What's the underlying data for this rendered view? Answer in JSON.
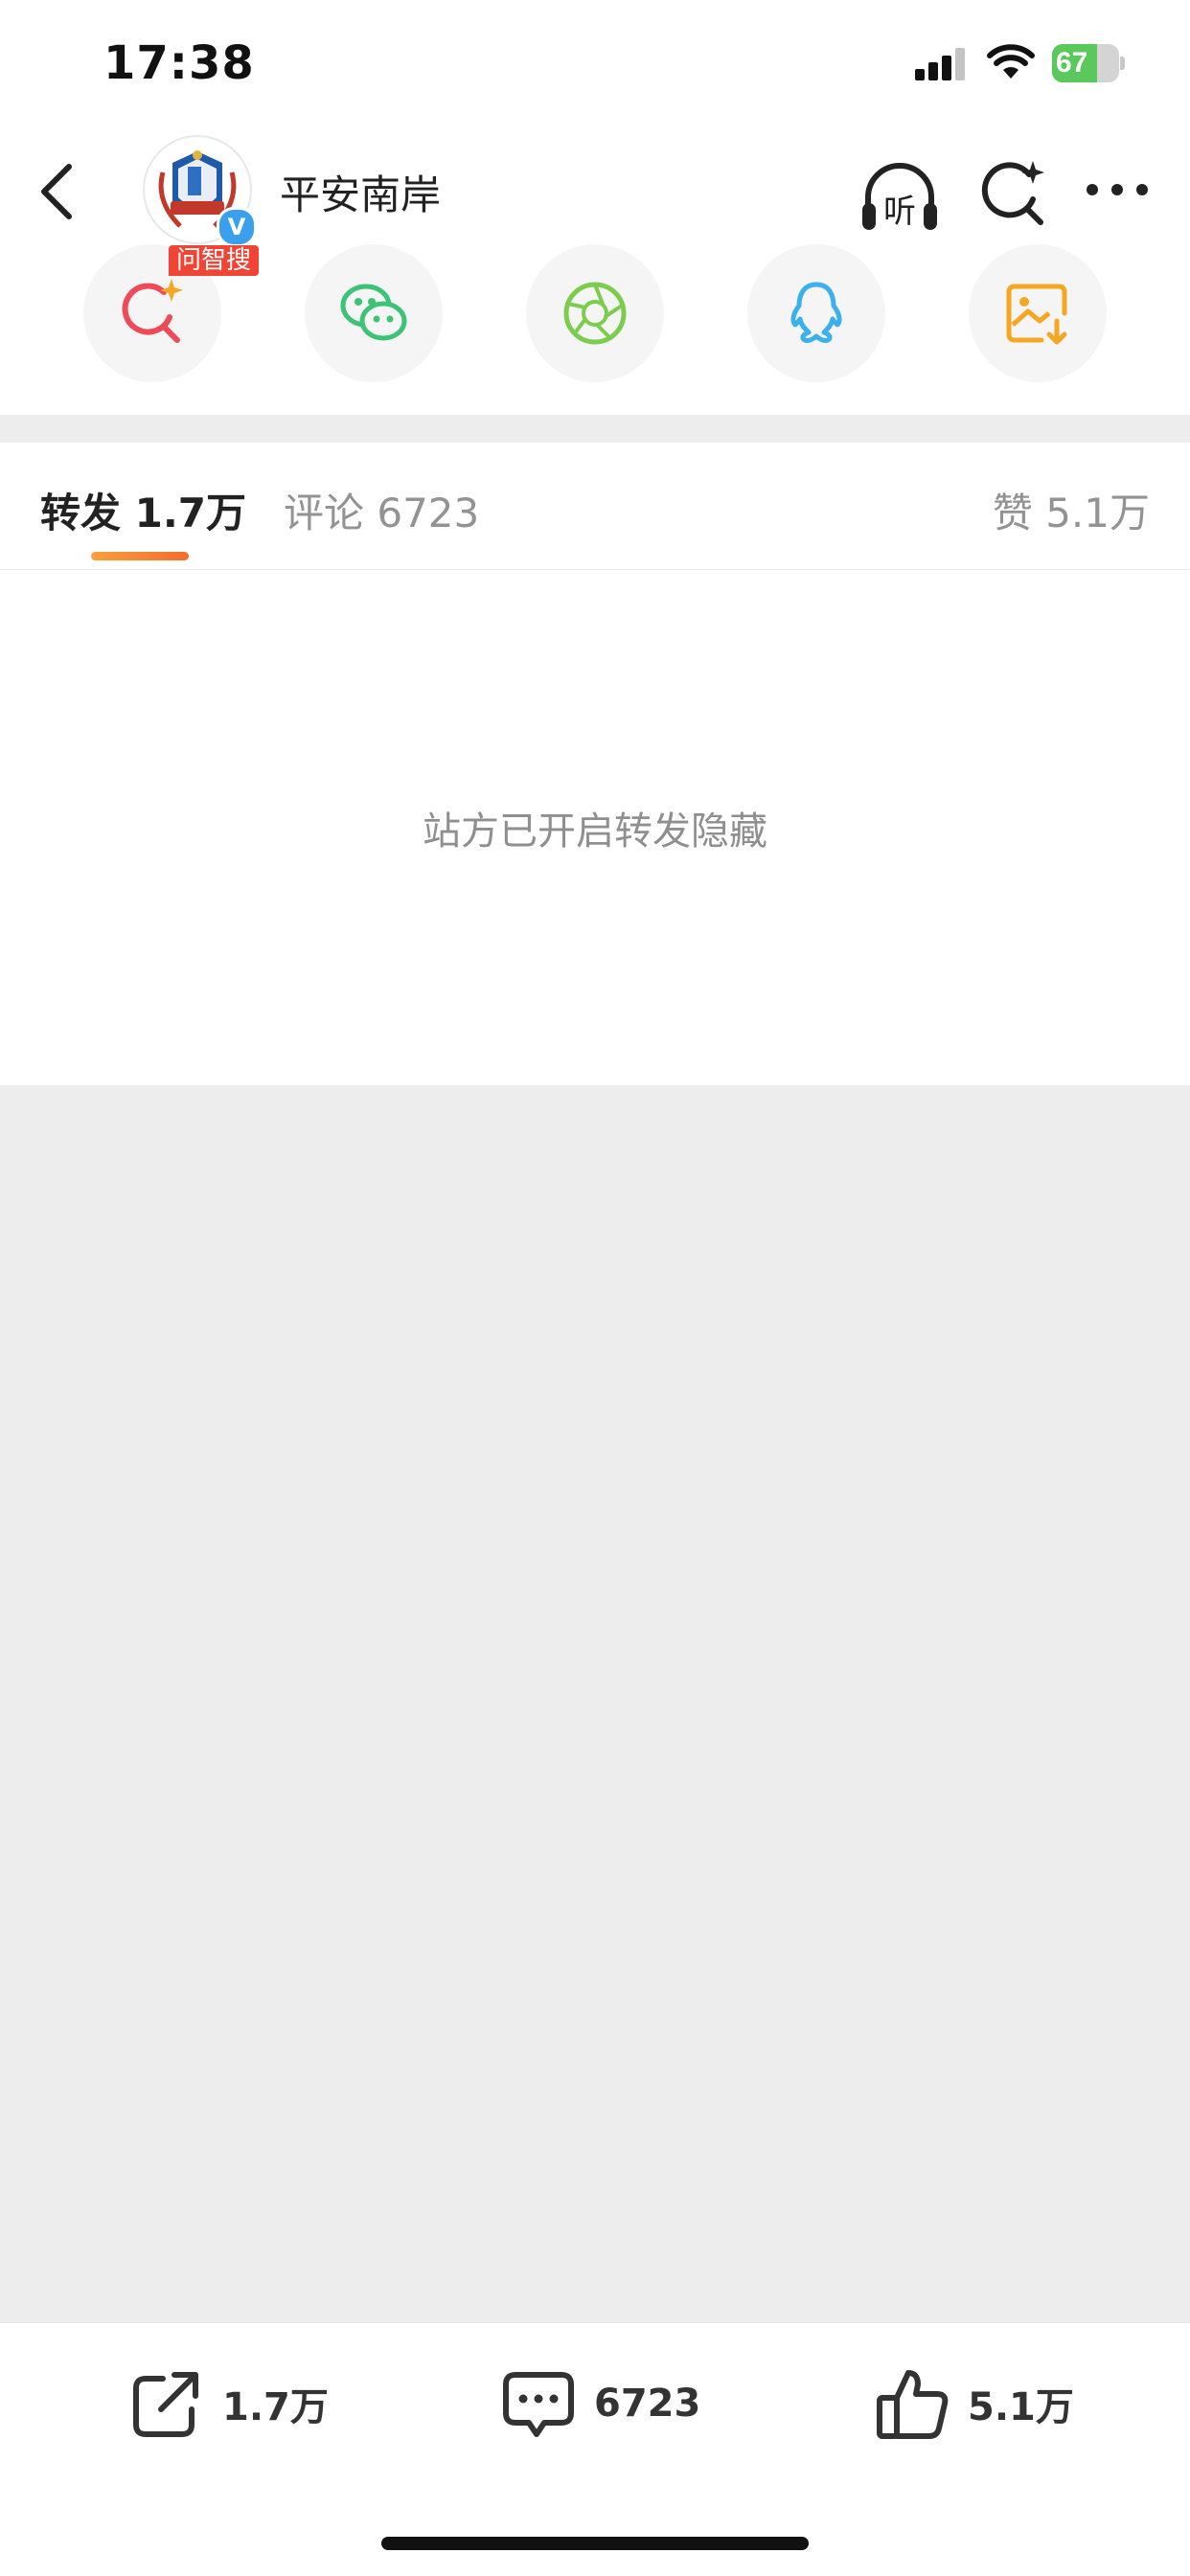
{
  "status_bar": {
    "time": "17:38",
    "battery_percent": 67
  },
  "nav": {
    "title": "平安南岸",
    "listen_icon_label": "听"
  },
  "share": {
    "ai_search_tag": "问智搜",
    "items": [
      {
        "id": "ai-search",
        "icon": "ai-search-icon",
        "color": "#ee4a5a"
      },
      {
        "id": "wechat",
        "icon": "wechat-icon",
        "color": "#3cc377"
      },
      {
        "id": "moments",
        "icon": "moments-icon",
        "color": "#7ccd4e"
      },
      {
        "id": "qq",
        "icon": "qq-icon",
        "color": "#3ab0ec"
      },
      {
        "id": "save-image",
        "icon": "save-image-icon",
        "color": "#f5a623"
      }
    ]
  },
  "tabs": {
    "repost_label": "转发 1.7万",
    "comments_label": "评论 6723",
    "likes_label": "赞 5.1万"
  },
  "content": {
    "hidden_message": "站方已开启转发隐藏"
  },
  "bottom_bar": {
    "repost_count": "1.7万",
    "comment_count": "6723",
    "like_count": "5.1万"
  }
}
